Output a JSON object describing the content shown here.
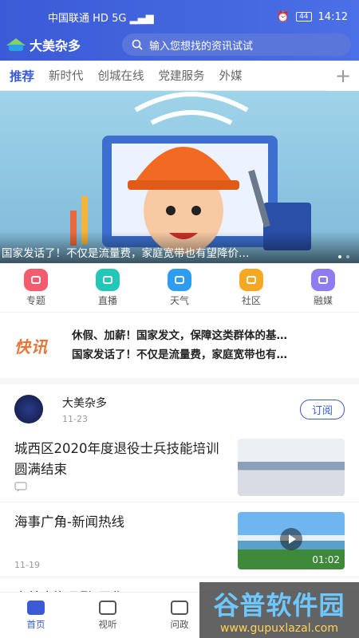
{
  "status": {
    "carrier": "中国联通",
    "net": "5G",
    "battery": "44",
    "time": "14:12"
  },
  "header": {
    "app_name": "大美杂多",
    "search_placeholder": "输入您想找的资讯试试"
  },
  "tabs": [
    "推荐",
    "新时代",
    "创城在线",
    "党建服务",
    "外媒"
  ],
  "banner": {
    "caption": "国家发话了！不仅是流量费，家庭宽带也有望降价…"
  },
  "quick": [
    {
      "label": "专题",
      "color": "#f25c6e"
    },
    {
      "label": "直播",
      "color": "#22c7b8"
    },
    {
      "label": "天气",
      "color": "#2e9cf0"
    },
    {
      "label": "社区",
      "color": "#f7a823"
    },
    {
      "label": "融媒",
      "color": "#8f7cf0"
    }
  ],
  "flash": {
    "logo": "快讯",
    "items": [
      "休假、加薪！国家发文，保障这类群体的基…",
      "国家发话了！不仅是流量费，家庭宽带也有…"
    ]
  },
  "account": {
    "name": "大美杂多",
    "date": "11-23",
    "subscribe": "订阅"
  },
  "news": [
    {
      "title": "城西区2020年度退役士兵技能培训圆满结束",
      "meta": "",
      "has_comment_icon": true
    },
    {
      "title": "海事广角-新闻热线",
      "meta": "11-19",
      "duration": "01:02"
    }
  ],
  "gallery_title": "大美青海县融-图集",
  "bottom_nav": [
    "首页",
    "视听",
    "问政"
  ],
  "watermark": {
    "big": "谷普软件园",
    "small": "www.gupuxlazal.com"
  }
}
